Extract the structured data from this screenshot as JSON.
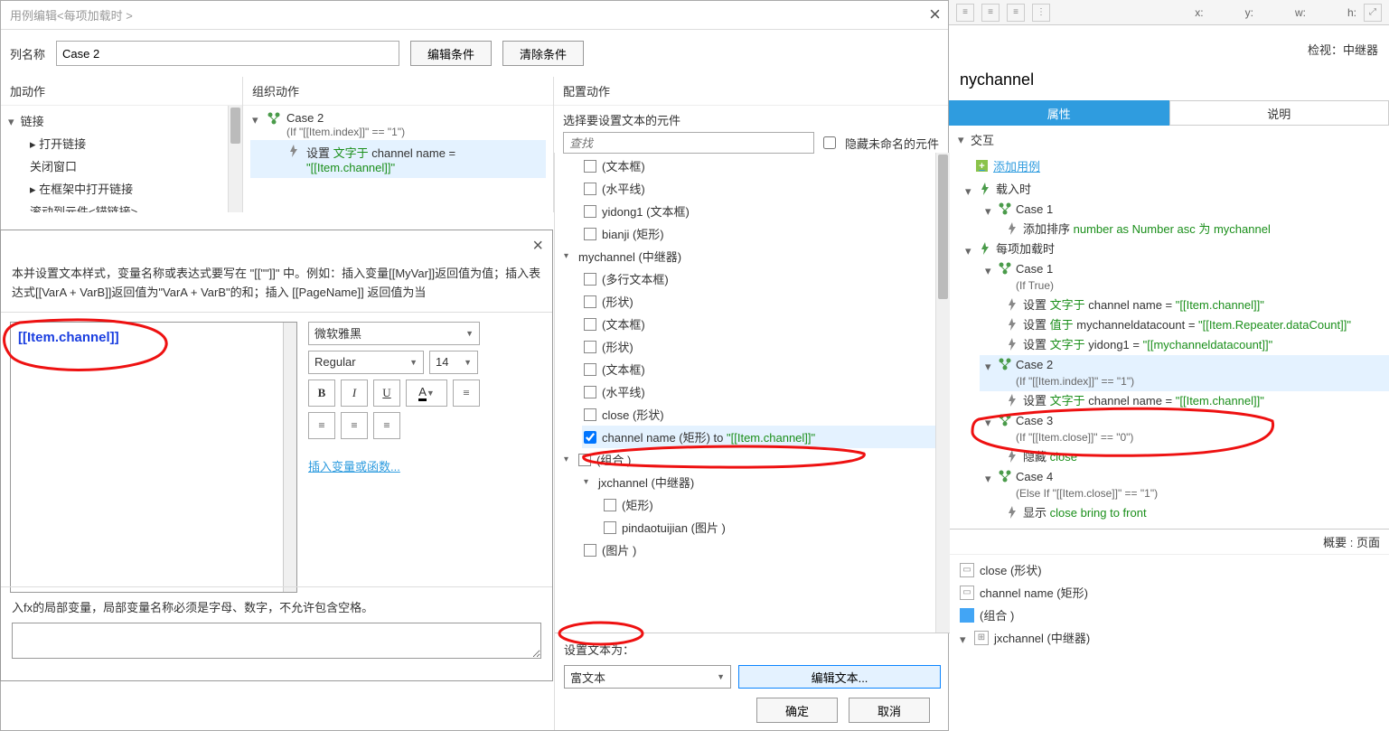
{
  "dialog": {
    "title": "用例编辑<每项加载时 >",
    "name_label": "列名称",
    "name_value": "Case 2",
    "btn_edit_condition": "编辑条件",
    "btn_clear_condition": "清除条件",
    "col_add_action": "加动作",
    "col_org_action": "组织动作",
    "col_cfg_action": "配置动作",
    "links_header": "链接",
    "links": [
      "打开链接",
      "关闭窗口",
      "在框架中打开链接",
      "滚动到元件<锚链接>"
    ],
    "org": {
      "case_name": "Case 2",
      "case_cond": "(If \"[[Item.index]]\" == \"1\")",
      "action_prefix": "设置 ",
      "action_green1": "文字于",
      "action_mid": " channel name = ",
      "action_green2": "\"[[Item.channel]]\""
    },
    "cfg_select_label": "选择要设置文本的元件",
    "cfg_search_placeholder": "查找",
    "cfg_hide_unnamed": "隐藏未命名的元件",
    "cfg_tree": [
      {
        "label": "(文本框)"
      },
      {
        "label": "(水平线)"
      },
      {
        "label": "yidong1 (文本框)"
      },
      {
        "label": "bianji (矩形)"
      }
    ],
    "cfg_my": {
      "label": "mychannel (中继器)",
      "children": [
        {
          "label": "(多行文本框)"
        },
        {
          "label": "(形状)"
        },
        {
          "label": "(文本框)"
        },
        {
          "label": "(形状)"
        },
        {
          "label": "(文本框)"
        },
        {
          "label": "(水平线)"
        },
        {
          "label": "close (形状)"
        },
        {
          "label": "channel name (矩形) to ",
          "suffix": "\"[[Item.channel]]\"",
          "checked": true
        }
      ]
    },
    "cfg_zh": {
      "label": "(组合 )"
    },
    "cfg_jx": {
      "label": "jxchannel (中继器)",
      "children": [
        {
          "label": "(矩形)"
        },
        {
          "label": "pindaotuijian (图片 )"
        }
      ]
    },
    "cfg_img": {
      "label": "(图片 )"
    },
    "cfg_settext": "设置文本为：",
    "cfg_mode": "富文本",
    "cfg_edit_btn": "编辑文本...",
    "btn_ok": "确定",
    "btn_cancel": "取消"
  },
  "rd": {
    "help": "本并设置文本样式，变量名称或表达式要写在 \"[[\"\"]]\" 中。例如：插入变量[[MyVar]]返回值为值；插入表达式[[VarA + VarB]]返回值为\"VarA + VarB\"的和；插入 [[PageName]] 返回值为当",
    "var_text": "[[Item.channel]]",
    "font": "微软雅黑",
    "weight": "Regular",
    "size": "14",
    "insert_link": "插入变量或函数...",
    "help2": "入fx的局部变量，局部变量名称必须是字母、数字，不允许包含空格。"
  },
  "toolbar": {
    "x": "x:",
    "y": "y:",
    "w": "w:",
    "h": "h:"
  },
  "view_label": "检视：中继器",
  "rp": {
    "title": "nychannel",
    "tab_props": "属性",
    "tab_notes": "说明",
    "interact_hdr": "交互",
    "add_case": "添加用例",
    "load_hdr": "载入时",
    "c1": {
      "name": "Case 1",
      "a_pre": "添加排序 ",
      "a_green": "number as Number asc 为 mychannel"
    },
    "each_hdr": "每项加载时",
    "ec1": {
      "name": "Case 1",
      "cond": "(If True)",
      "a1_pre": "设置 ",
      "a1_g1": "文字于",
      "a1_mid": " channel name = ",
      "a1_g2": "\"[[Item.channel]]\"",
      "a2_pre": "设置 ",
      "a2_g1": "值于",
      "a2_mid": " mychanneldatacount = ",
      "a2_g2": "\"[[Item.Repeater.dataCount]]\"",
      "a3_pre": "设置 ",
      "a3_g1": "文字于",
      "a3_mid": " yidong1 = ",
      "a3_g2": "\"[[mychanneldatacount]]\""
    },
    "ec2": {
      "name": "Case 2",
      "cond": "(If \"[[Item.index]]\" == \"1\")",
      "a_pre": "设置 ",
      "a_g1": "文字于",
      "a_mid": " channel name = ",
      "a_g2": "\"[[Item.channel]]\""
    },
    "ec3": {
      "name": "Case 3",
      "cond": "(If \"[[Item.close]]\" == \"0\")",
      "a_pre": "隐藏 ",
      "a_g": "close"
    },
    "ec4": {
      "name": "Case 4",
      "cond": "(Else If \"[[Item.close]]\" == \"1\")",
      "a_pre": "显示 ",
      "a_g": "close bring to front"
    },
    "outline_hdr": "概要 : 页面",
    "outline": [
      {
        "label": "close (形状)"
      },
      {
        "label": "channel name (矩形)"
      },
      {
        "label": "(组合 )",
        "folder": true
      },
      {
        "label": "jxchannel (中继器)",
        "grid": true
      }
    ]
  }
}
